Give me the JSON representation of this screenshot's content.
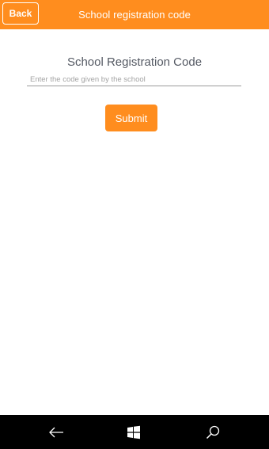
{
  "colors": {
    "accent": "#ff8d1e",
    "navbar": "#000000"
  },
  "header": {
    "back_label": "Back",
    "title": "School registration code"
  },
  "main": {
    "heading": "School Registration Code",
    "code_input": {
      "value": "",
      "placeholder": "Enter the code given by the school"
    },
    "submit_label": "Submit"
  },
  "system_nav": {
    "icons": [
      "back-arrow-icon",
      "windows-logo-icon",
      "search-icon"
    ]
  }
}
